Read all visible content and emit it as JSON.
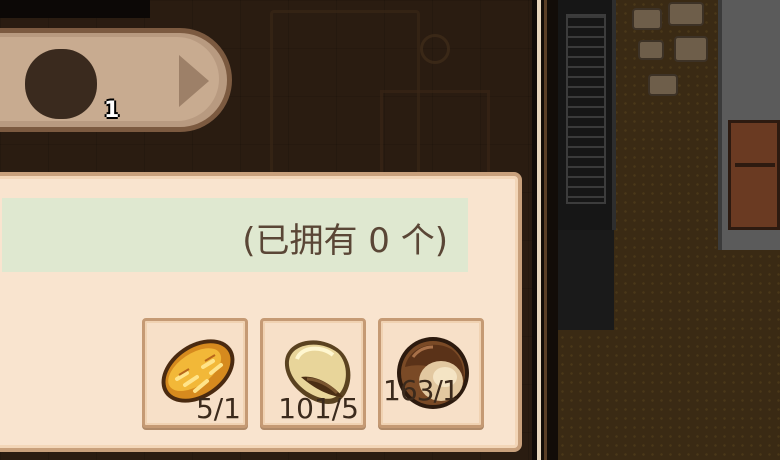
{
  "quick_slot": {
    "count": "1"
  },
  "recipe_panel": {
    "owned_text": "(已拥有 0 个)",
    "ingredients": [
      {
        "icon": "bread-icon",
        "count": "5/1"
      },
      {
        "icon": "seed-icon",
        "count": "101/5"
      },
      {
        "icon": "nut-icon",
        "count": "163/1"
      }
    ]
  },
  "colors": {
    "panel_bg": "#f9e4cf",
    "panel_border": "#c8a07c",
    "owned_bar_bg": "#dfe8d0",
    "text": "#5a4636"
  }
}
